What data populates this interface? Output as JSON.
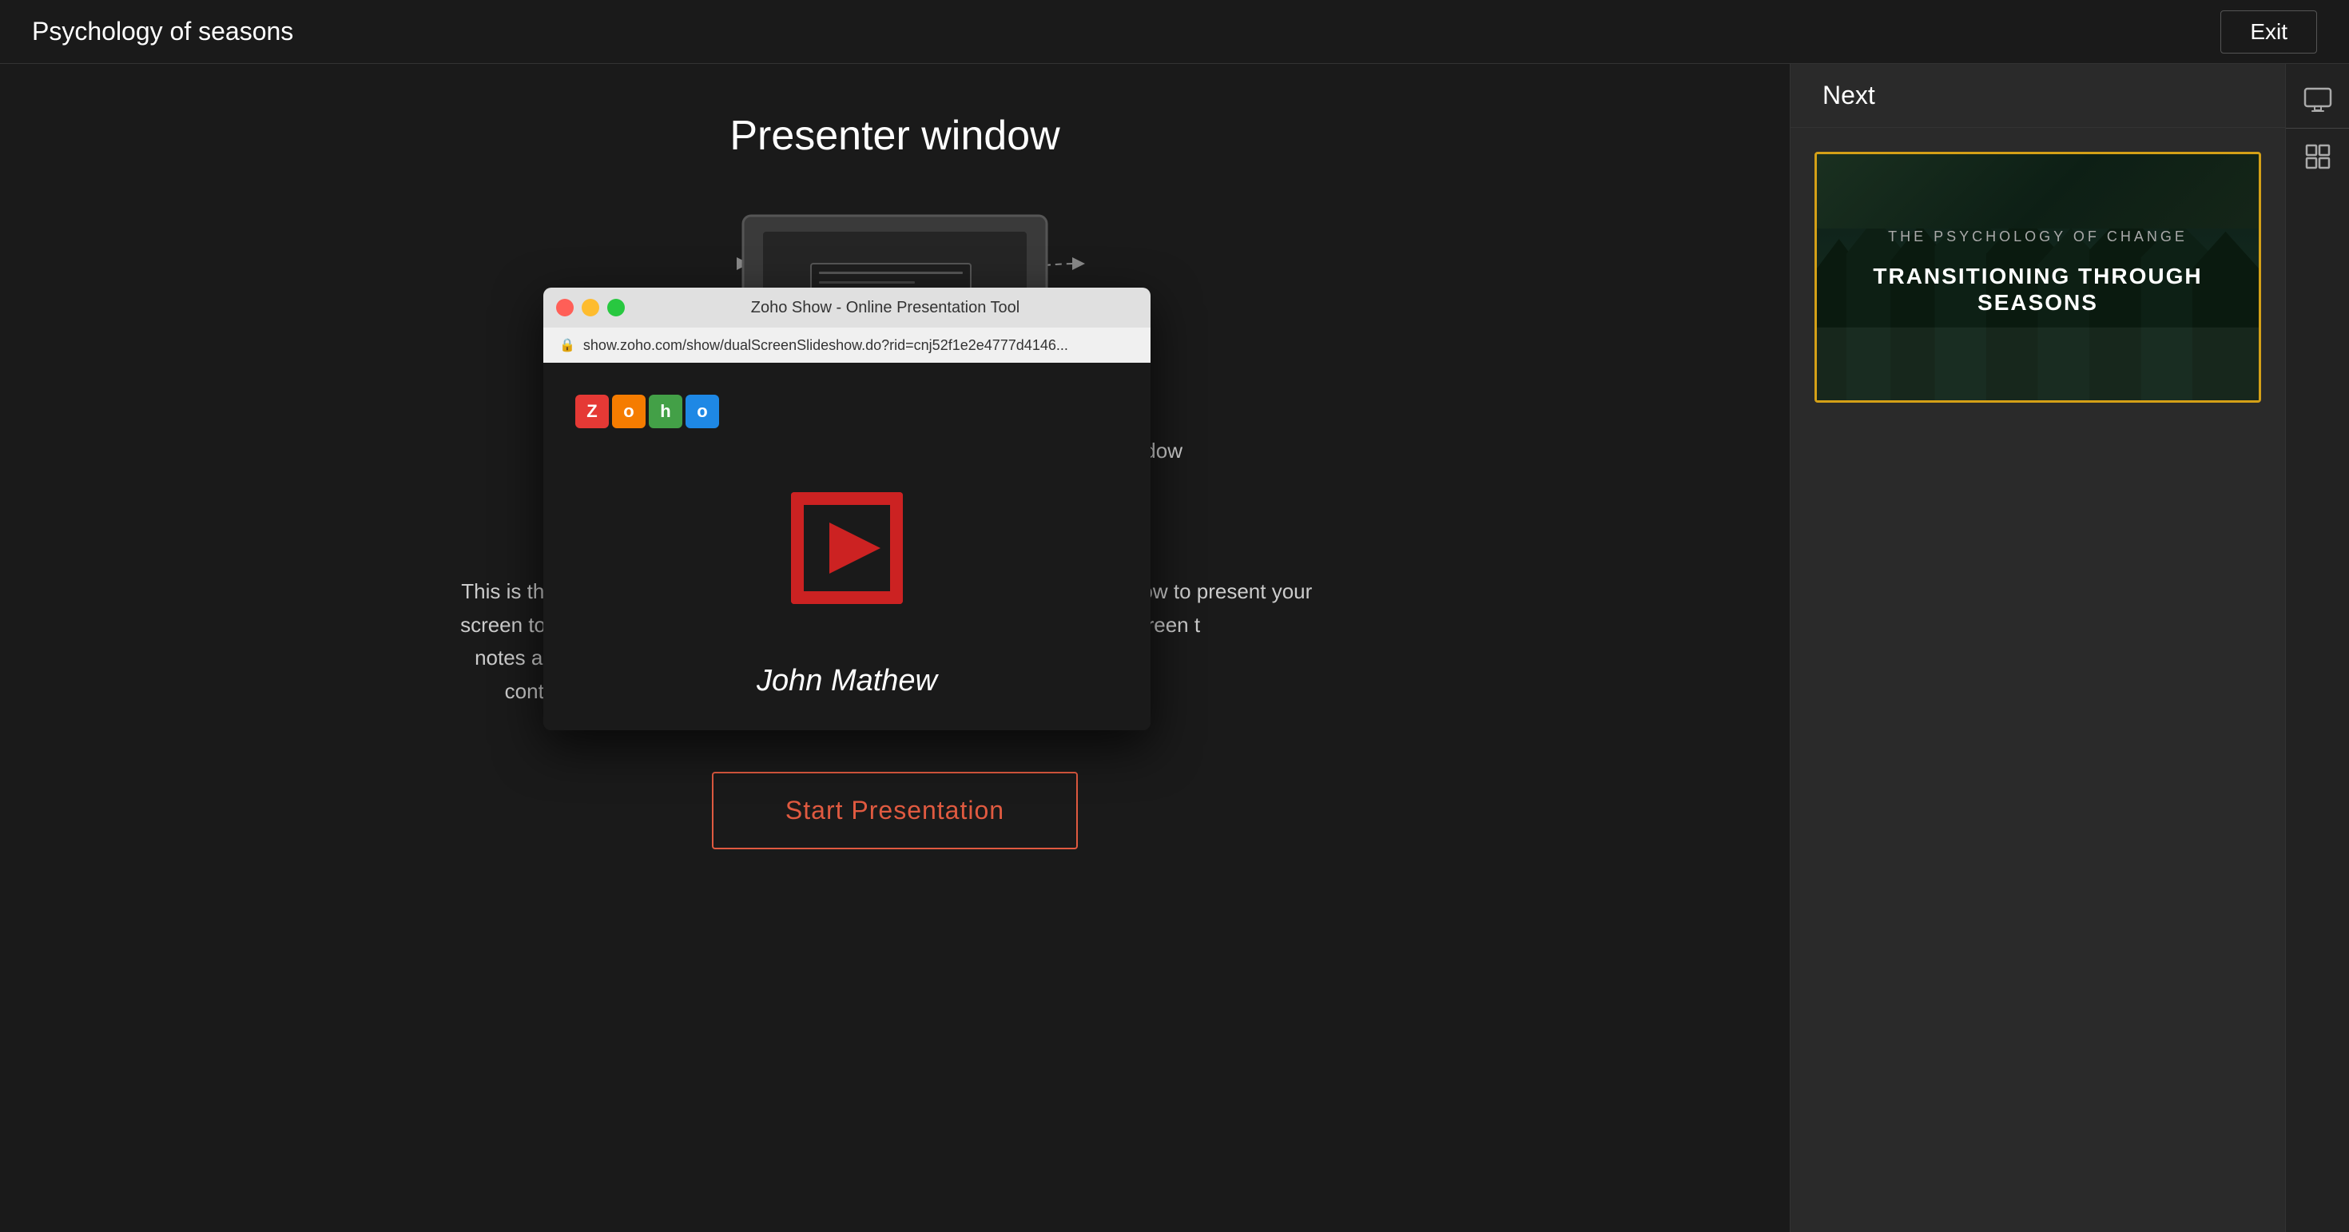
{
  "header": {
    "title": "Psychology of seasons",
    "exit_label": "Exit"
  },
  "sidebar": {
    "next_label": "Next"
  },
  "presenter_area": {
    "window_title": "Presenter window",
    "presenter_label": "Presenter window",
    "audience_label": "Audience window",
    "description_left": "This is the 'Presenter's Window'. Use this screen to select specific slides, view slide notes and more, without disturbing the content on the projector screen.",
    "description_right": "The Audience window to present your slide screen t",
    "start_button_label": "Start Presentation"
  },
  "slide_thumbnail": {
    "subtitle": "THE PSYCHOLOGY OF CHANGE",
    "title_line1": "TRANSITIONING THROUGH",
    "title_line2": "SEASONS"
  },
  "popup": {
    "title": "Zoho Show - Online Presentation Tool",
    "url": "show.zoho.com/show/dualScreenSlideshow.do?rid=cnj52f1e2e4777d4146...",
    "zoho_letters": [
      "Z",
      "o",
      "h",
      "o"
    ],
    "presenter_name": "John Mathew"
  },
  "icons": {
    "present_icon": "▣",
    "grid_icon": "⊞",
    "lock_symbol": "🔒"
  }
}
